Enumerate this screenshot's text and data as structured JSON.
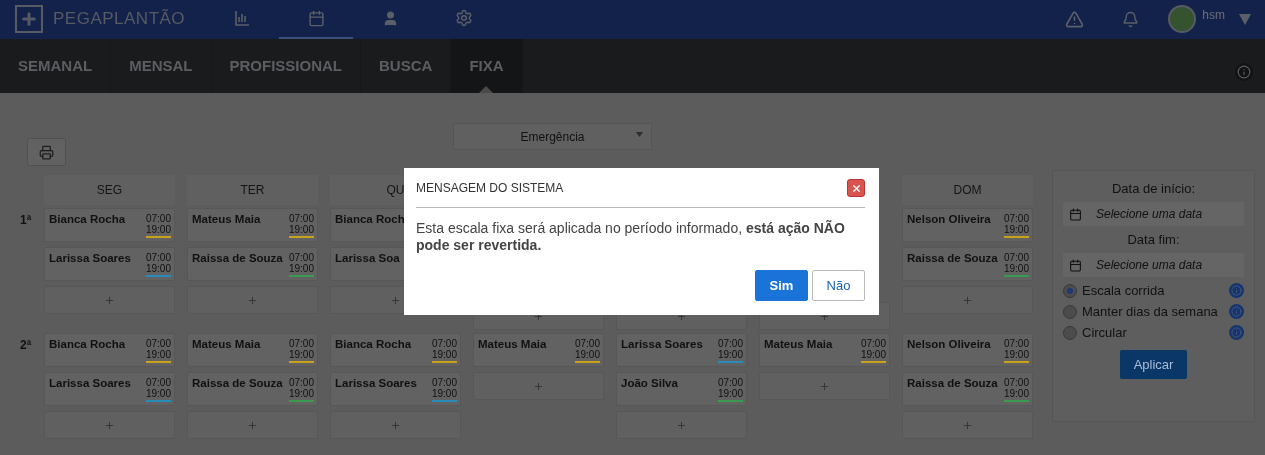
{
  "topbar": {
    "brand": "PEGAPLANTÃO",
    "nav": [
      {
        "kind": "chart",
        "selected": false
      },
      {
        "kind": "calendar",
        "selected": true
      },
      {
        "kind": "user",
        "selected": false
      },
      {
        "kind": "settings",
        "selected": false
      }
    ],
    "user": "hsm"
  },
  "tabs": [
    {
      "label": "SEMANAL",
      "selected": false
    },
    {
      "label": "MENSAL",
      "selected": false
    },
    {
      "label": "PROFISSIONAL",
      "selected": false
    },
    {
      "label": "BUSCA",
      "selected": false
    },
    {
      "label": "FIXA",
      "selected": true
    }
  ],
  "sector": "Emergência",
  "grid": {
    "headers": [
      "SEG",
      "TER",
      "QU",
      "DOM"
    ],
    "rows": [
      {
        "label": "1ª",
        "columns": [
          [
            {
              "kind": "shift",
              "name": "Bianca Rocha",
              "start": "07:00",
              "end": "19:00",
              "color": "#c9a21b"
            },
            {
              "kind": "shift",
              "name": "Larissa Soares",
              "start": "07:00",
              "end": "19:00",
              "color": "#2a8ab8"
            },
            {
              "kind": "add"
            }
          ],
          [
            {
              "kind": "shift",
              "name": "Mateus Maia",
              "start": "07:00",
              "end": "19:00",
              "color": "#c9a21b"
            },
            {
              "kind": "shift",
              "name": "Raissa de Souza",
              "start": "07:00",
              "end": "19:00",
              "color": "#3a9a50"
            },
            {
              "kind": "add"
            }
          ],
          [
            {
              "kind": "shift",
              "name": "Bianca Roch"
            },
            {
              "kind": "shift",
              "name": "Larissa Soa"
            },
            {
              "kind": "add"
            }
          ],
          [
            {
              "kind": "add"
            }
          ],
          [
            {
              "kind": "add"
            }
          ],
          [
            {
              "kind": "add"
            }
          ],
          [
            {
              "kind": "shift",
              "name": "Nelson Oliveira",
              "start": "07:00",
              "end": "19:00",
              "color": "#c9a21b"
            },
            {
              "kind": "shift",
              "name": "Raissa de Souza",
              "start": "07:00",
              "end": "19:00",
              "color": "#3a9a50"
            },
            {
              "kind": "add"
            }
          ]
        ]
      },
      {
        "label": "2ª",
        "columns": [
          [
            {
              "kind": "shift",
              "name": "Bianca Rocha",
              "start": "07:00",
              "end": "19:00",
              "color": "#c9a21b"
            },
            {
              "kind": "shift",
              "name": "Larissa Soares",
              "start": "07:00",
              "end": "19:00",
              "color": "#2a8ab8"
            },
            {
              "kind": "add"
            }
          ],
          [
            {
              "kind": "shift",
              "name": "Mateus Maia",
              "start": "07:00",
              "end": "19:00",
              "color": "#c9a21b"
            },
            {
              "kind": "shift",
              "name": "Raissa de Souza",
              "start": "07:00",
              "end": "19:00",
              "color": "#3a9a50"
            },
            {
              "kind": "add"
            }
          ],
          [
            {
              "kind": "shift",
              "name": "Bianca Rocha",
              "start": "07:00",
              "end": "19:00",
              "color": "#c9a21b"
            },
            {
              "kind": "shift",
              "name": "Larissa Soares",
              "start": "07:00",
              "end": "19:00",
              "color": "#2a8ab8"
            },
            {
              "kind": "add"
            }
          ],
          [
            {
              "kind": "shift",
              "name": "Mateus Maia",
              "start": "07:00",
              "end": "19:00",
              "color": "#c9a21b"
            },
            {
              "kind": "add"
            }
          ],
          [
            {
              "kind": "shift",
              "name": "Larissa Soares",
              "start": "07:00",
              "end": "19:00",
              "color": "#2a8ab8"
            },
            {
              "kind": "shift",
              "name": "João Silva",
              "start": "07:00",
              "end": "19:00",
              "color": "#3a9a50"
            },
            {
              "kind": "add"
            }
          ],
          [
            {
              "kind": "shift",
              "name": "Mateus Maia",
              "start": "07:00",
              "end": "19:00",
              "color": "#c9a21b"
            },
            {
              "kind": "add"
            }
          ],
          [
            {
              "kind": "shift",
              "name": "Nelson Oliveira",
              "start": "07:00",
              "end": "19:00",
              "color": "#c9a21b"
            },
            {
              "kind": "shift",
              "name": "Raissa de Souza",
              "start": "07:00",
              "end": "19:00",
              "color": "#3a9a50"
            },
            {
              "kind": "add"
            }
          ]
        ]
      }
    ]
  },
  "panel": {
    "start_label": "Data de início:",
    "start_placeholder": "Selecione uma data",
    "end_label": "Data fim:",
    "end_placeholder": "Selecione uma data",
    "options": [
      {
        "label": "Escala corrida",
        "selected": true
      },
      {
        "label": "Manter dias da semana",
        "selected": false
      },
      {
        "label": "Circular",
        "selected": false
      }
    ],
    "apply": "Aplicar"
  },
  "dialog": {
    "title": "MENSAGEM DO SISTEMA",
    "message": "Esta escala fixa será aplicada no período informado, **está ação NÃO pode ser revertida.**",
    "buttons": [
      {
        "label": "Sim",
        "kind": "primary"
      },
      {
        "label": "Não",
        "kind": "secondary"
      }
    ]
  }
}
